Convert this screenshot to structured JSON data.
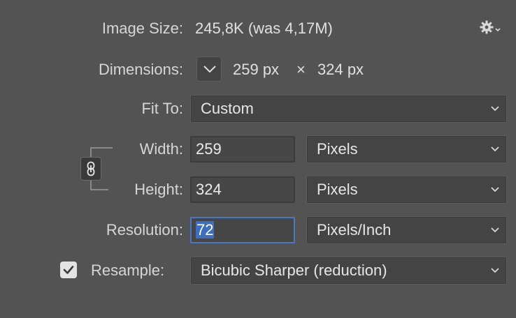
{
  "image_size": {
    "label": "Image Size:",
    "value": "245,8K (was 4,17M)"
  },
  "settings_menu": {
    "icon": "gear-icon"
  },
  "dimensions": {
    "label": "Dimensions:",
    "width_value": "259 px",
    "times": "×",
    "height_value": "324 px",
    "dropdown_icon": "chevron-down-icon"
  },
  "fit_to": {
    "label": "Fit To:",
    "selected": "Custom"
  },
  "width": {
    "label": "Width:",
    "value": "259",
    "unit": "Pixels"
  },
  "height": {
    "label": "Height:",
    "value": "324",
    "unit": "Pixels"
  },
  "constrain": {
    "icon": "link-chain-icon",
    "active": true
  },
  "resolution": {
    "label": "Resolution:",
    "value": "72",
    "unit": "Pixels/Inch"
  },
  "resample": {
    "checked": true,
    "label": "Resample:",
    "method": "Bicubic Sharper (reduction)"
  },
  "colors": {
    "background": "#535353",
    "control": "#444444",
    "focus": "#4a78c6",
    "selection": "#3d6fc0"
  }
}
